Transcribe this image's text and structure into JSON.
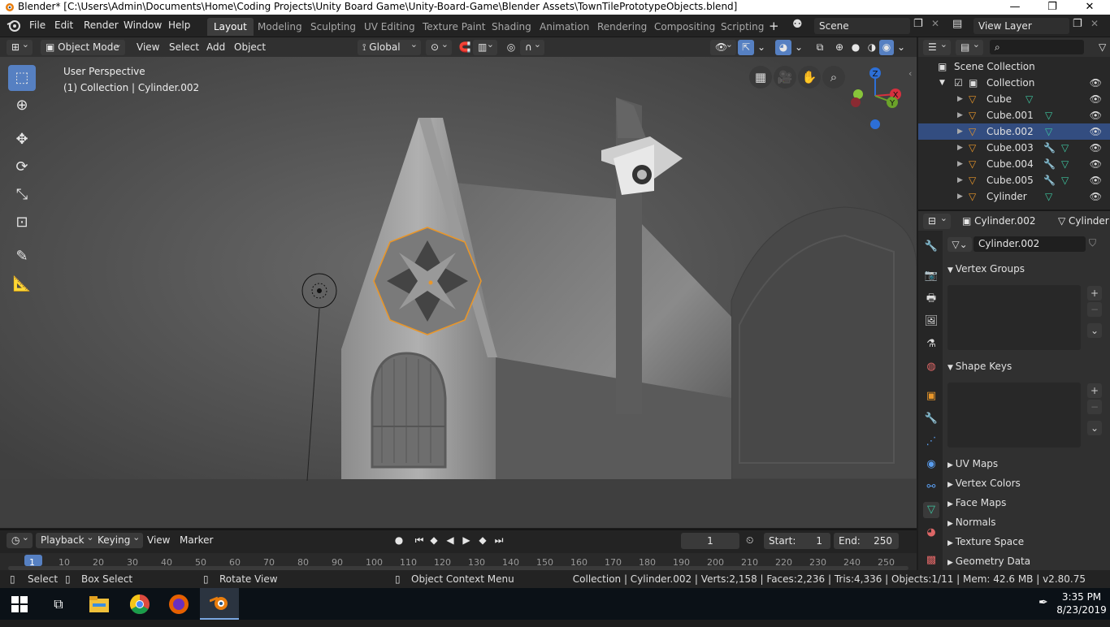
{
  "window": {
    "title": "Blender* [C:\\Users\\Admin\\Documents\\Home\\Coding Projects\\Unity Board Game\\Unity-Board-Game\\Blender Assets\\TownTilePrototypeObjects.blend]"
  },
  "menu": [
    "File",
    "Edit",
    "Render",
    "Window",
    "Help"
  ],
  "workspaces": [
    "Layout",
    "Modeling",
    "Sculpting",
    "UV Editing",
    "Texture Paint",
    "Shading",
    "Animation",
    "Rendering",
    "Compositing",
    "Scripting"
  ],
  "active_workspace": "Layout",
  "scene": {
    "name": "Scene",
    "view_layer": "View Layer"
  },
  "viewport_header": {
    "mode": "Object Mode",
    "menus": [
      "View",
      "Select",
      "Add",
      "Object"
    ],
    "orientation": "Global"
  },
  "viewport": {
    "perspective": "User Perspective",
    "collection_info": "(1) Collection | Cylinder.002",
    "gizmo": {
      "x": "X",
      "y": "Y",
      "z": "Z"
    }
  },
  "outliner": {
    "root": "Scene Collection",
    "collection": "Collection",
    "items": [
      {
        "name": "Cube",
        "modifier": false,
        "selected": false
      },
      {
        "name": "Cube.001",
        "modifier": false,
        "selected": false
      },
      {
        "name": "Cube.002",
        "modifier": false,
        "selected": true
      },
      {
        "name": "Cube.003",
        "modifier": true,
        "selected": false
      },
      {
        "name": "Cube.004",
        "modifier": true,
        "selected": false
      },
      {
        "name": "Cube.005",
        "modifier": true,
        "selected": false
      },
      {
        "name": "Cylinder",
        "modifier": false,
        "selected": false
      }
    ]
  },
  "properties": {
    "object_name": "Cylinder.002",
    "data_name_trunc": "Cylinder",
    "mesh_name": "Cylinder.002",
    "panels_open": [
      "Vertex Groups",
      "Shape Keys"
    ],
    "panels_closed": [
      "UV Maps",
      "Vertex Colors",
      "Face Maps",
      "Normals",
      "Texture Space",
      "Geometry Data"
    ]
  },
  "timeline": {
    "menus": [
      "Playback",
      "Keying",
      "View",
      "Marker"
    ],
    "current_frame": "1",
    "start_label": "Start:",
    "start": "1",
    "end_label": "End:",
    "end": "250",
    "ticks": [
      "1",
      "10",
      "20",
      "30",
      "40",
      "50",
      "60",
      "70",
      "80",
      "90",
      "100",
      "110",
      "120",
      "130",
      "140",
      "150",
      "160",
      "170",
      "180",
      "190",
      "200",
      "210",
      "220",
      "230",
      "240",
      "250"
    ]
  },
  "statusbar": {
    "select": "Select",
    "box_select": "Box Select",
    "rotate_view": "Rotate View",
    "context_menu": "Object Context Menu",
    "stats": "Collection | Cylinder.002 | Verts:2,158 | Faces:2,236 | Tris:4,336 | Objects:1/11 | Mem: 42.6 MB | v2.80.75"
  },
  "taskbar": {
    "time": "3:35 PM",
    "date": "8/23/2019"
  },
  "colors": {
    "accent": "#5680c2",
    "selection_outline": "#e8962a",
    "outliner_selected": "#334d80"
  }
}
